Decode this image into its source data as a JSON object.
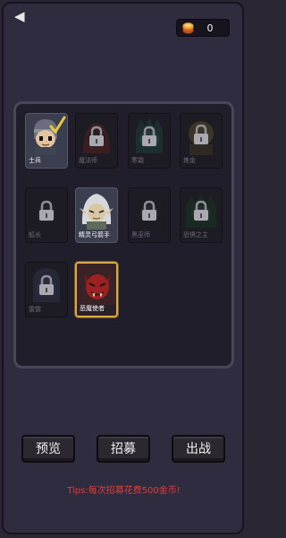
{
  "header": {
    "back_icon": "back-arrow-icon",
    "coin_count": "0",
    "coin_icon": "gold-coin-icon"
  },
  "heroes": [
    {
      "name": "士兵",
      "state": "unlocked",
      "checked": true
    },
    {
      "name": "魔法师",
      "state": "locked"
    },
    {
      "name": "寒霜",
      "state": "locked"
    },
    {
      "name": "炼金",
      "state": "locked"
    },
    {
      "name": "船长",
      "state": "locked"
    },
    {
      "name": "精灵弓箭手",
      "state": "unlocked"
    },
    {
      "name": "黑巫师",
      "state": "locked"
    },
    {
      "name": "恐惧之主",
      "state": "locked"
    },
    {
      "name": "雷霆",
      "state": "locked"
    },
    {
      "name": "恶魔使者",
      "state": "selected"
    }
  ],
  "buttons": {
    "preview": "预览",
    "recruit": "招募",
    "battle": "出战"
  },
  "tips": "Tips:每次招募花费500金币!",
  "colors": {
    "background": "#2a2634",
    "panel": "#211e2c",
    "tips_text": "#e03c3c",
    "selected_border": "#d8a84a",
    "coin": "#f08a1e"
  }
}
